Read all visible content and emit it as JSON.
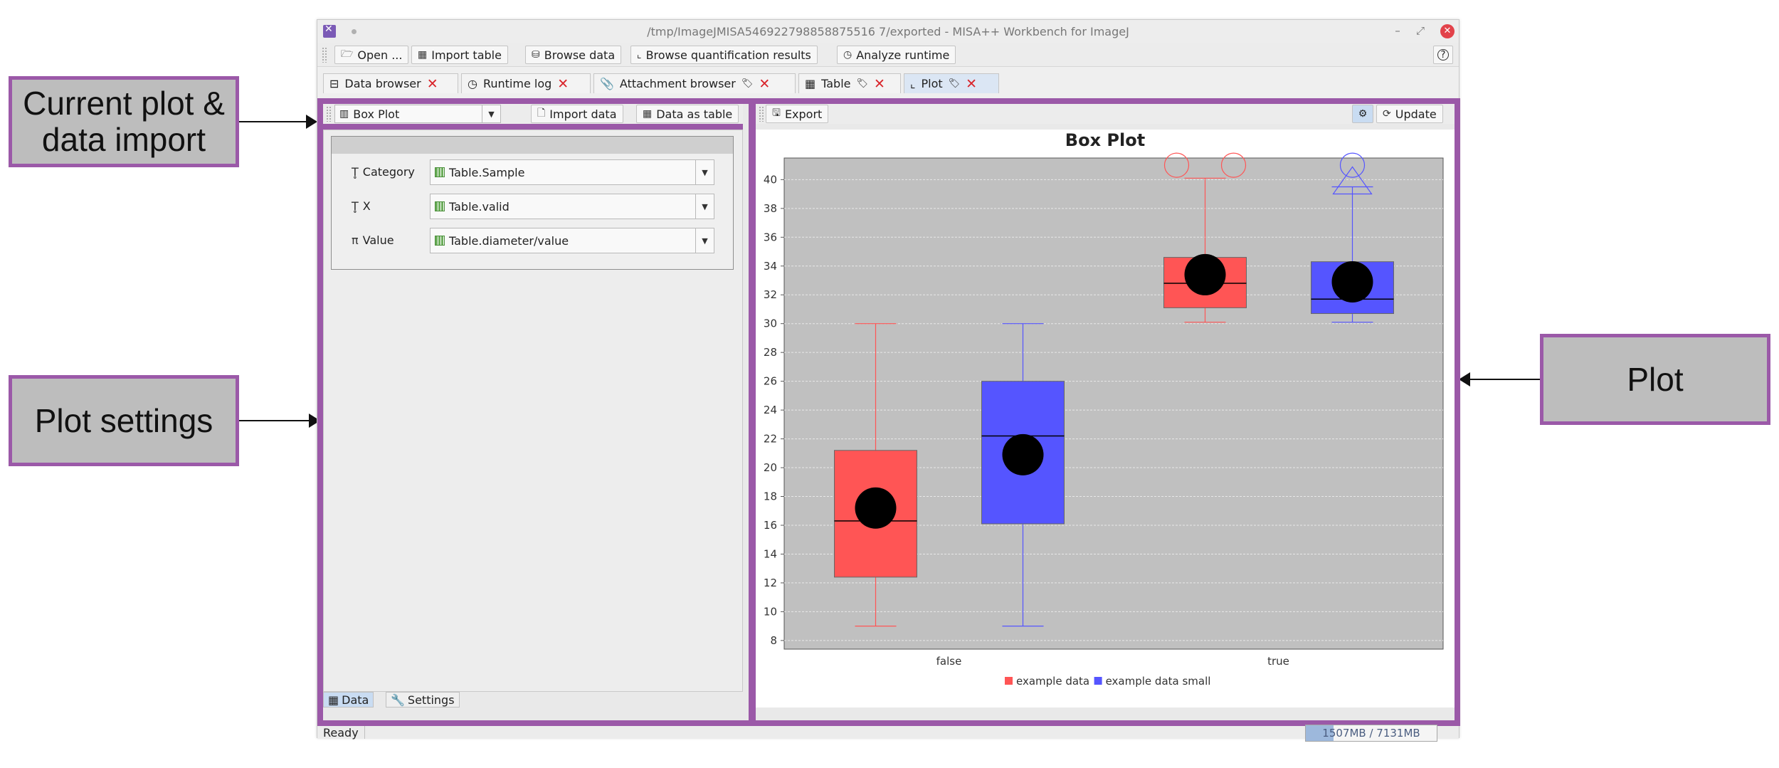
{
  "annotations": {
    "current_plot": "Current plot &\ndata import",
    "plot_settings": "Plot settings",
    "plot": "Plot"
  },
  "window": {
    "title": "/tmp/ImageJMISA546922798858875516 7/exported - MISA++ Workbench for ImageJ",
    "controls": {
      "minimize": "–",
      "maximize": "⤢",
      "close": "✕"
    }
  },
  "toolbar": {
    "open": "Open ...",
    "import_table": "Import table",
    "browse_data": "Browse data",
    "browse_quant": "Browse quantification results",
    "analyze_runtime": "Analyze runtime",
    "help": "?"
  },
  "tabs": [
    {
      "label": "Data browser",
      "icon": "table-icon"
    },
    {
      "label": "Runtime log",
      "icon": "clock-icon"
    },
    {
      "label": "Attachment browser",
      "icon": "paperclip-icon"
    },
    {
      "label": "Table",
      "icon": "table-icon"
    },
    {
      "label": "Plot",
      "icon": "chart-icon"
    }
  ],
  "left_toolbar": {
    "plot_type": "Box Plot",
    "import_data": "Import data",
    "data_as_table": "Data as table"
  },
  "parameters": [
    {
      "label": "Category",
      "icon": "text-type-icon",
      "value": "Table.Sample"
    },
    {
      "label": "X",
      "icon": "text-type-icon",
      "value": "Table.valid"
    },
    {
      "label": "Value",
      "icon": "pi-icon",
      "value": "Table.diameter/value"
    }
  ],
  "bottom_tabs": {
    "data": "Data",
    "settings": "Settings"
  },
  "right_toolbar": {
    "export": "Export",
    "update": "Update"
  },
  "status": {
    "text": "Ready",
    "memory": "1507MB / 7131MB",
    "memory_fraction": 0.21
  },
  "chart_data": {
    "type": "box",
    "title": "Box Plot",
    "xlabel": "",
    "ylabel": "",
    "categories": [
      "false",
      "true"
    ],
    "ylim": [
      7.4,
      41.5
    ],
    "yticks": [
      8,
      10,
      12,
      14,
      16,
      18,
      20,
      22,
      24,
      26,
      28,
      30,
      32,
      34,
      36,
      38,
      40
    ],
    "grid": true,
    "legend_position": "bottom",
    "series": [
      {
        "name": "example data",
        "color": "#ff5555",
        "boxes": [
          {
            "category": "false",
            "whisker_low": 9,
            "q1": 12.4,
            "median": 16.3,
            "q3": 21.2,
            "whisker_high": 30,
            "mean": 17.2,
            "outliers": []
          },
          {
            "category": "true",
            "whisker_low": 30.1,
            "q1": 31.1,
            "median": 32.8,
            "q3": 34.6,
            "whisker_high": 40.1,
            "mean": 33.4,
            "outliers": [
              41,
              41
            ]
          }
        ]
      },
      {
        "name": "example data small",
        "color": "#5555ff",
        "boxes": [
          {
            "category": "false",
            "whisker_low": 9,
            "q1": 16.1,
            "median": 22.2,
            "q3": 26.0,
            "whisker_high": 30,
            "mean": 20.9,
            "outliers": []
          },
          {
            "category": "true",
            "whisker_low": 30.1,
            "q1": 30.7,
            "median": 31.7,
            "q3": 34.3,
            "whisker_high": 39.5,
            "mean": 32.9,
            "outliers": [
              41
            ]
          }
        ]
      }
    ]
  }
}
